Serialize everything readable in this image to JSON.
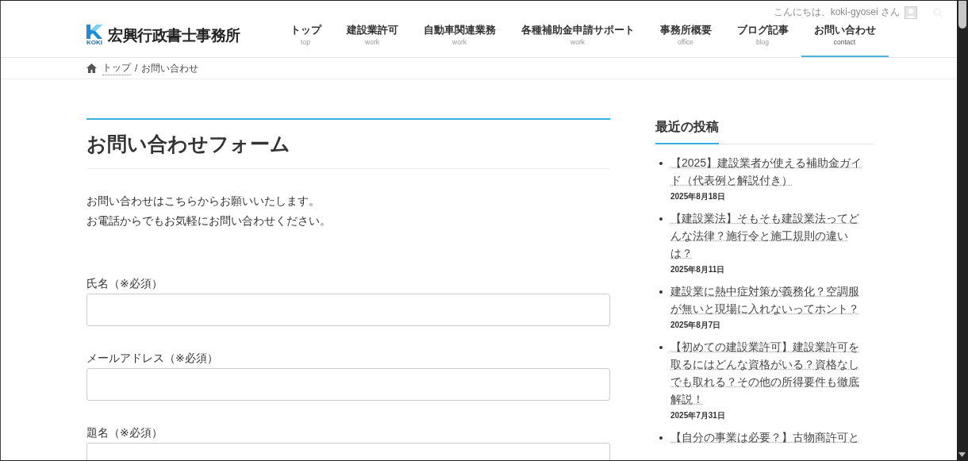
{
  "site": {
    "logo_mark": "KOKI",
    "name": "宏興行政書士事務所"
  },
  "admin_bar": {
    "greeting": "こんにちは、koki-gyosei さん"
  },
  "nav": [
    {
      "label": "トップ",
      "sub": "top",
      "selected": false
    },
    {
      "label": "建設業許可",
      "sub": "work",
      "selected": false
    },
    {
      "label": "自動車関連業務",
      "sub": "work",
      "selected": false
    },
    {
      "label": "各種補助金申請サポート",
      "sub": "work",
      "selected": false
    },
    {
      "label": "事務所概要",
      "sub": "office",
      "selected": false
    },
    {
      "label": "ブログ記事",
      "sub": "blog",
      "selected": false
    },
    {
      "label": "お問い合わせ",
      "sub": "contact",
      "selected": true
    }
  ],
  "breadcrumb": {
    "separator": "/",
    "items": [
      "トップ",
      "お問い合わせ"
    ]
  },
  "page": {
    "title": "お問い合わせフォーム",
    "intro": [
      "お問い合わせはこちらからお願いいたします。",
      "お電話からでもお気軽にお問い合わせください。"
    ],
    "fields": [
      {
        "label": "氏名（※必須）"
      },
      {
        "label": "メールアドレス（※必須）"
      },
      {
        "label": "題名（※必須）"
      }
    ]
  },
  "sidebar": {
    "title": "最近の投稿",
    "posts": [
      {
        "title": "【2025】建設業者が使える補助金ガイド（代表例と解説付き）",
        "date": "2025年8月18日"
      },
      {
        "title": "【建設業法】そもそも建設業法ってどんな法律？施行令と施工規則の違いは？",
        "date": "2025年8月11日"
      },
      {
        "title": "建設業に熱中症対策が義務化？空調服が無いと現場に入れないってホント？",
        "date": "2025年8月7日"
      },
      {
        "title": "【初めての建設業許可】建設業許可を取るにはどんな資格がいる？資格なしでも取れる？その他の所得要件も徹底解説！",
        "date": "2025年7月31日"
      },
      {
        "title": "【自分の事業は必要？】古物商許可と"
      }
    ]
  }
}
